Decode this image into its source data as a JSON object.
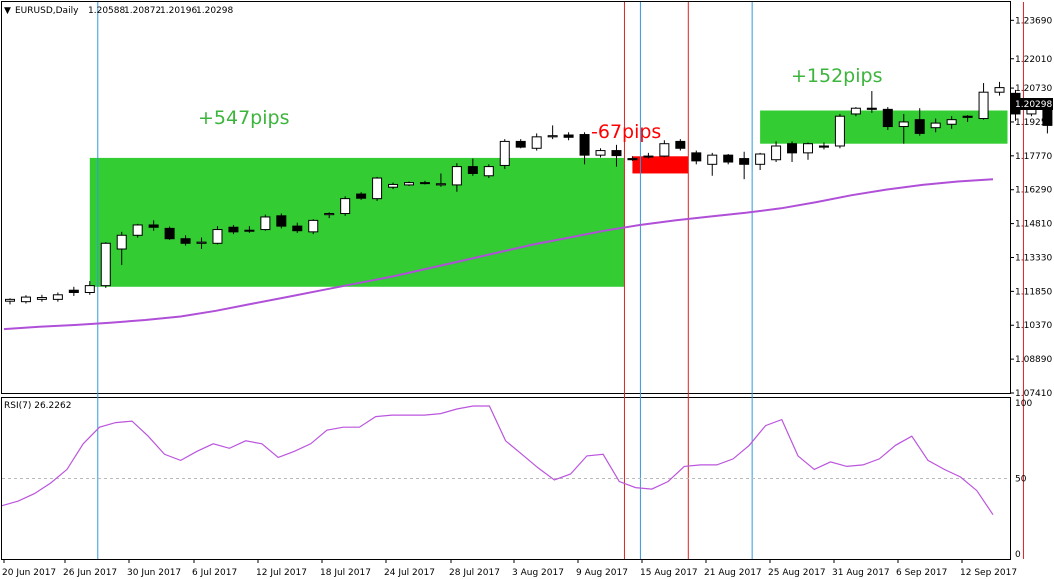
{
  "header": {
    "symbol_tf": "EURUSD,Daily",
    "open": "1.20588",
    "high": "1.20872",
    "low": "1.20196",
    "close": "1.20298"
  },
  "rsi": {
    "label": "RSI(7) 26.2262",
    "ticks": [
      "100",
      "50",
      "0"
    ]
  },
  "annotations": [
    {
      "text": "+547pips",
      "color": "#3cb53c"
    },
    {
      "text": "-67pips",
      "color": "#ff0000"
    },
    {
      "text": "+152pips",
      "color": "#3cb53c"
    }
  ],
  "colors": {
    "profit_box": "#33cc33",
    "loss_box": "#ff0000",
    "ma_line": "#b04fd8",
    "rsi_line": "#bb55dd",
    "entry_line": "#3399dd",
    "exit_line": "#dd2222"
  },
  "chart_data": {
    "type": "candlestick",
    "symbol": "EURUSD",
    "timeframe": "Daily",
    "ylim": [
      1.0741,
      1.2449
    ],
    "y_ticks": [
      "1.23690",
      "1.22010",
      "1.20730",
      "1.19250",
      "1.17770",
      "1.16290",
      "1.14810",
      "1.13330",
      "1.11850",
      "1.10370",
      "1.08890",
      "1.07410"
    ],
    "x_ticks": [
      "20 Jun 2017",
      "26 Jun 2017",
      "30 Jun 2017",
      "6 Jul 2017",
      "12 Jul 2017",
      "18 Jul 2017",
      "24 Jul 2017",
      "28 Jul 2017",
      "3 Aug 2017",
      "9 Aug 2017",
      "15 Aug 2017",
      "21 Aug 2017",
      "25 Aug 2017",
      "31 Aug 2017",
      "6 Sep 2017",
      "12 Sep 2017"
    ],
    "candles": [
      {
        "o": 1.1142,
        "h": 1.1155,
        "l": 1.1128,
        "c": 1.115
      },
      {
        "o": 1.114,
        "h": 1.1168,
        "l": 1.1132,
        "c": 1.116
      },
      {
        "o": 1.115,
        "h": 1.117,
        "l": 1.114,
        "c": 1.1158
      },
      {
        "o": 1.115,
        "h": 1.118,
        "l": 1.114,
        "c": 1.117
      },
      {
        "o": 1.119,
        "h": 1.1205,
        "l": 1.1165,
        "c": 1.118
      },
      {
        "o": 1.118,
        "h": 1.123,
        "l": 1.117,
        "c": 1.121
      },
      {
        "o": 1.121,
        "h": 1.14,
        "l": 1.12,
        "c": 1.1395
      },
      {
        "o": 1.137,
        "h": 1.1445,
        "l": 1.13,
        "c": 1.143
      },
      {
        "o": 1.143,
        "h": 1.148,
        "l": 1.142,
        "c": 1.1475
      },
      {
        "o": 1.1475,
        "h": 1.1495,
        "l": 1.145,
        "c": 1.1465
      },
      {
        "o": 1.146,
        "h": 1.1468,
        "l": 1.141,
        "c": 1.1415
      },
      {
        "o": 1.1415,
        "h": 1.143,
        "l": 1.1385,
        "c": 1.1395
      },
      {
        "o": 1.1395,
        "h": 1.142,
        "l": 1.137,
        "c": 1.14
      },
      {
        "o": 1.1395,
        "h": 1.147,
        "l": 1.139,
        "c": 1.1455
      },
      {
        "o": 1.1465,
        "h": 1.1475,
        "l": 1.1435,
        "c": 1.1445
      },
      {
        "o": 1.1448,
        "h": 1.147,
        "l": 1.144,
        "c": 1.1452
      },
      {
        "o": 1.1455,
        "h": 1.152,
        "l": 1.145,
        "c": 1.151
      },
      {
        "o": 1.1515,
        "h": 1.1525,
        "l": 1.146,
        "c": 1.147
      },
      {
        "o": 1.147,
        "h": 1.1485,
        "l": 1.144,
        "c": 1.145
      },
      {
        "o": 1.1445,
        "h": 1.15,
        "l": 1.1435,
        "c": 1.1495
      },
      {
        "o": 1.152,
        "h": 1.153,
        "l": 1.1505,
        "c": 1.1525
      },
      {
        "o": 1.1525,
        "h": 1.16,
        "l": 1.1515,
        "c": 1.159
      },
      {
        "o": 1.161,
        "h": 1.1618,
        "l": 1.1585,
        "c": 1.1592
      },
      {
        "o": 1.159,
        "h": 1.1685,
        "l": 1.158,
        "c": 1.168
      },
      {
        "o": 1.164,
        "h": 1.166,
        "l": 1.1632,
        "c": 1.1652
      },
      {
        "o": 1.165,
        "h": 1.1665,
        "l": 1.1645,
        "c": 1.166
      },
      {
        "o": 1.166,
        "h": 1.1668,
        "l": 1.1652,
        "c": 1.1658
      },
      {
        "o": 1.165,
        "h": 1.17,
        "l": 1.1642,
        "c": 1.1655
      },
      {
        "o": 1.165,
        "h": 1.1745,
        "l": 1.162,
        "c": 1.173
      },
      {
        "o": 1.173,
        "h": 1.1765,
        "l": 1.169,
        "c": 1.17
      },
      {
        "o": 1.169,
        "h": 1.174,
        "l": 1.168,
        "c": 1.173
      },
      {
        "o": 1.1735,
        "h": 1.185,
        "l": 1.172,
        "c": 1.184
      },
      {
        "o": 1.184,
        "h": 1.185,
        "l": 1.181,
        "c": 1.1815
      },
      {
        "o": 1.181,
        "h": 1.1875,
        "l": 1.18,
        "c": 1.186
      },
      {
        "o": 1.186,
        "h": 1.191,
        "l": 1.185,
        "c": 1.1865
      },
      {
        "o": 1.1868,
        "h": 1.188,
        "l": 1.1845,
        "c": 1.1858
      },
      {
        "o": 1.187,
        "h": 1.188,
        "l": 1.174,
        "c": 1.178
      },
      {
        "o": 1.178,
        "h": 1.181,
        "l": 1.177,
        "c": 1.18
      },
      {
        "o": 1.18,
        "h": 1.1825,
        "l": 1.173,
        "c": 1.1778
      },
      {
        "o": 1.1765,
        "h": 1.1775,
        "l": 1.1755,
        "c": 1.176
      },
      {
        "o": 1.1772,
        "h": 1.179,
        "l": 1.1765,
        "c": 1.1776
      },
      {
        "o": 1.1776,
        "h": 1.1845,
        "l": 1.177,
        "c": 1.183
      },
      {
        "o": 1.184,
        "h": 1.185,
        "l": 1.18,
        "c": 1.181
      },
      {
        "o": 1.179,
        "h": 1.18,
        "l": 1.174,
        "c": 1.1755
      },
      {
        "o": 1.174,
        "h": 1.179,
        "l": 1.169,
        "c": 1.178
      },
      {
        "o": 1.178,
        "h": 1.1785,
        "l": 1.174,
        "c": 1.175
      },
      {
        "o": 1.1765,
        "h": 1.1795,
        "l": 1.1675,
        "c": 1.174
      },
      {
        "o": 1.174,
        "h": 1.179,
        "l": 1.1715,
        "c": 1.1785
      },
      {
        "o": 1.176,
        "h": 1.184,
        "l": 1.175,
        "c": 1.182
      },
      {
        "o": 1.183,
        "h": 1.184,
        "l": 1.175,
        "c": 1.179
      },
      {
        "o": 1.179,
        "h": 1.1835,
        "l": 1.176,
        "c": 1.183
      },
      {
        "o": 1.182,
        "h": 1.1835,
        "l": 1.1805,
        "c": 1.1815
      },
      {
        "o": 1.182,
        "h": 1.196,
        "l": 1.181,
        "c": 1.195
      },
      {
        "o": 1.196,
        "h": 1.199,
        "l": 1.195,
        "c": 1.1985
      },
      {
        "o": 1.1985,
        "h": 1.206,
        "l": 1.1965,
        "c": 1.198
      },
      {
        "o": 1.198,
        "h": 1.199,
        "l": 1.189,
        "c": 1.1905
      },
      {
        "o": 1.1905,
        "h": 1.196,
        "l": 1.183,
        "c": 1.1925
      },
      {
        "o": 1.1935,
        "h": 1.1985,
        "l": 1.1865,
        "c": 1.1875
      },
      {
        "o": 1.19,
        "h": 1.194,
        "l": 1.188,
        "c": 1.192
      },
      {
        "o": 1.1915,
        "h": 1.195,
        "l": 1.1895,
        "c": 1.1935
      },
      {
        "o": 1.195,
        "h": 1.1955,
        "l": 1.1925,
        "c": 1.1945
      },
      {
        "o": 1.194,
        "h": 1.2095,
        "l": 1.1935,
        "c": 1.2055
      },
      {
        "o": 1.2055,
        "h": 1.21,
        "l": 1.204,
        "c": 1.2075
      },
      {
        "o": 1.205,
        "h": 1.2065,
        "l": 1.193,
        "c": 1.196
      },
      {
        "o": 1.196,
        "h": 1.1995,
        "l": 1.195,
        "c": 1.1985
      },
      {
        "o": 1.199,
        "h": 1.1995,
        "l": 1.1875,
        "c": 1.191
      },
      {
        "o": 1.191,
        "h": 1.1955,
        "l": 1.185,
        "c": 1.1945
      }
    ],
    "moving_average": [
      1.102,
      1.103,
      1.1038,
      1.1048,
      1.106,
      1.1075,
      1.11,
      1.113,
      1.116,
      1.119,
      1.122,
      1.125,
      1.1285,
      1.132,
      1.1355,
      1.139,
      1.142,
      1.145,
      1.1475,
      1.1495,
      1.1512,
      1.1528,
      1.1548,
      1.1575,
      1.1605,
      1.163,
      1.165,
      1.1665,
      1.1675
    ],
    "rsi_values": [
      32,
      35,
      40,
      47,
      56,
      73,
      84,
      87,
      88,
      78,
      66,
      62,
      68,
      73,
      70,
      75,
      73,
      64,
      68,
      73,
      82,
      84,
      84,
      91,
      92,
      92,
      92,
      93,
      96,
      98,
      98,
      75,
      66,
      57,
      49,
      53,
      65,
      66,
      48,
      44,
      43,
      48,
      58,
      59,
      59,
      63,
      72,
      85,
      89,
      65,
      56,
      61,
      58,
      59,
      63,
      72,
      78,
      62,
      56,
      51,
      42,
      26
    ],
    "rsi_levels": [
      50
    ],
    "rsi_ylim": [
      0,
      100
    ],
    "trade_boxes": [
      {
        "result": "win",
        "from_bar": 5,
        "to_bar": 38,
        "top": 1.1768,
        "bottom": 1.1205
      },
      {
        "result": "loss",
        "from_bar": 39,
        "to_bar": 42,
        "top": 1.1775,
        "bottom": 1.17
      },
      {
        "result": "win",
        "from_bar": 47,
        "to_bar": 62,
        "top": 1.1975,
        "bottom": 1.183
      }
    ],
    "vertical_lines": [
      {
        "kind": "entry",
        "bar": 5.5
      },
      {
        "kind": "exit",
        "bar": 38.5
      },
      {
        "kind": "entry",
        "bar": 39.5
      },
      {
        "kind": "exit",
        "bar": 42.5
      },
      {
        "kind": "entry",
        "bar": 46.5
      },
      {
        "kind": "exit",
        "bar": 63.5
      }
    ]
  }
}
